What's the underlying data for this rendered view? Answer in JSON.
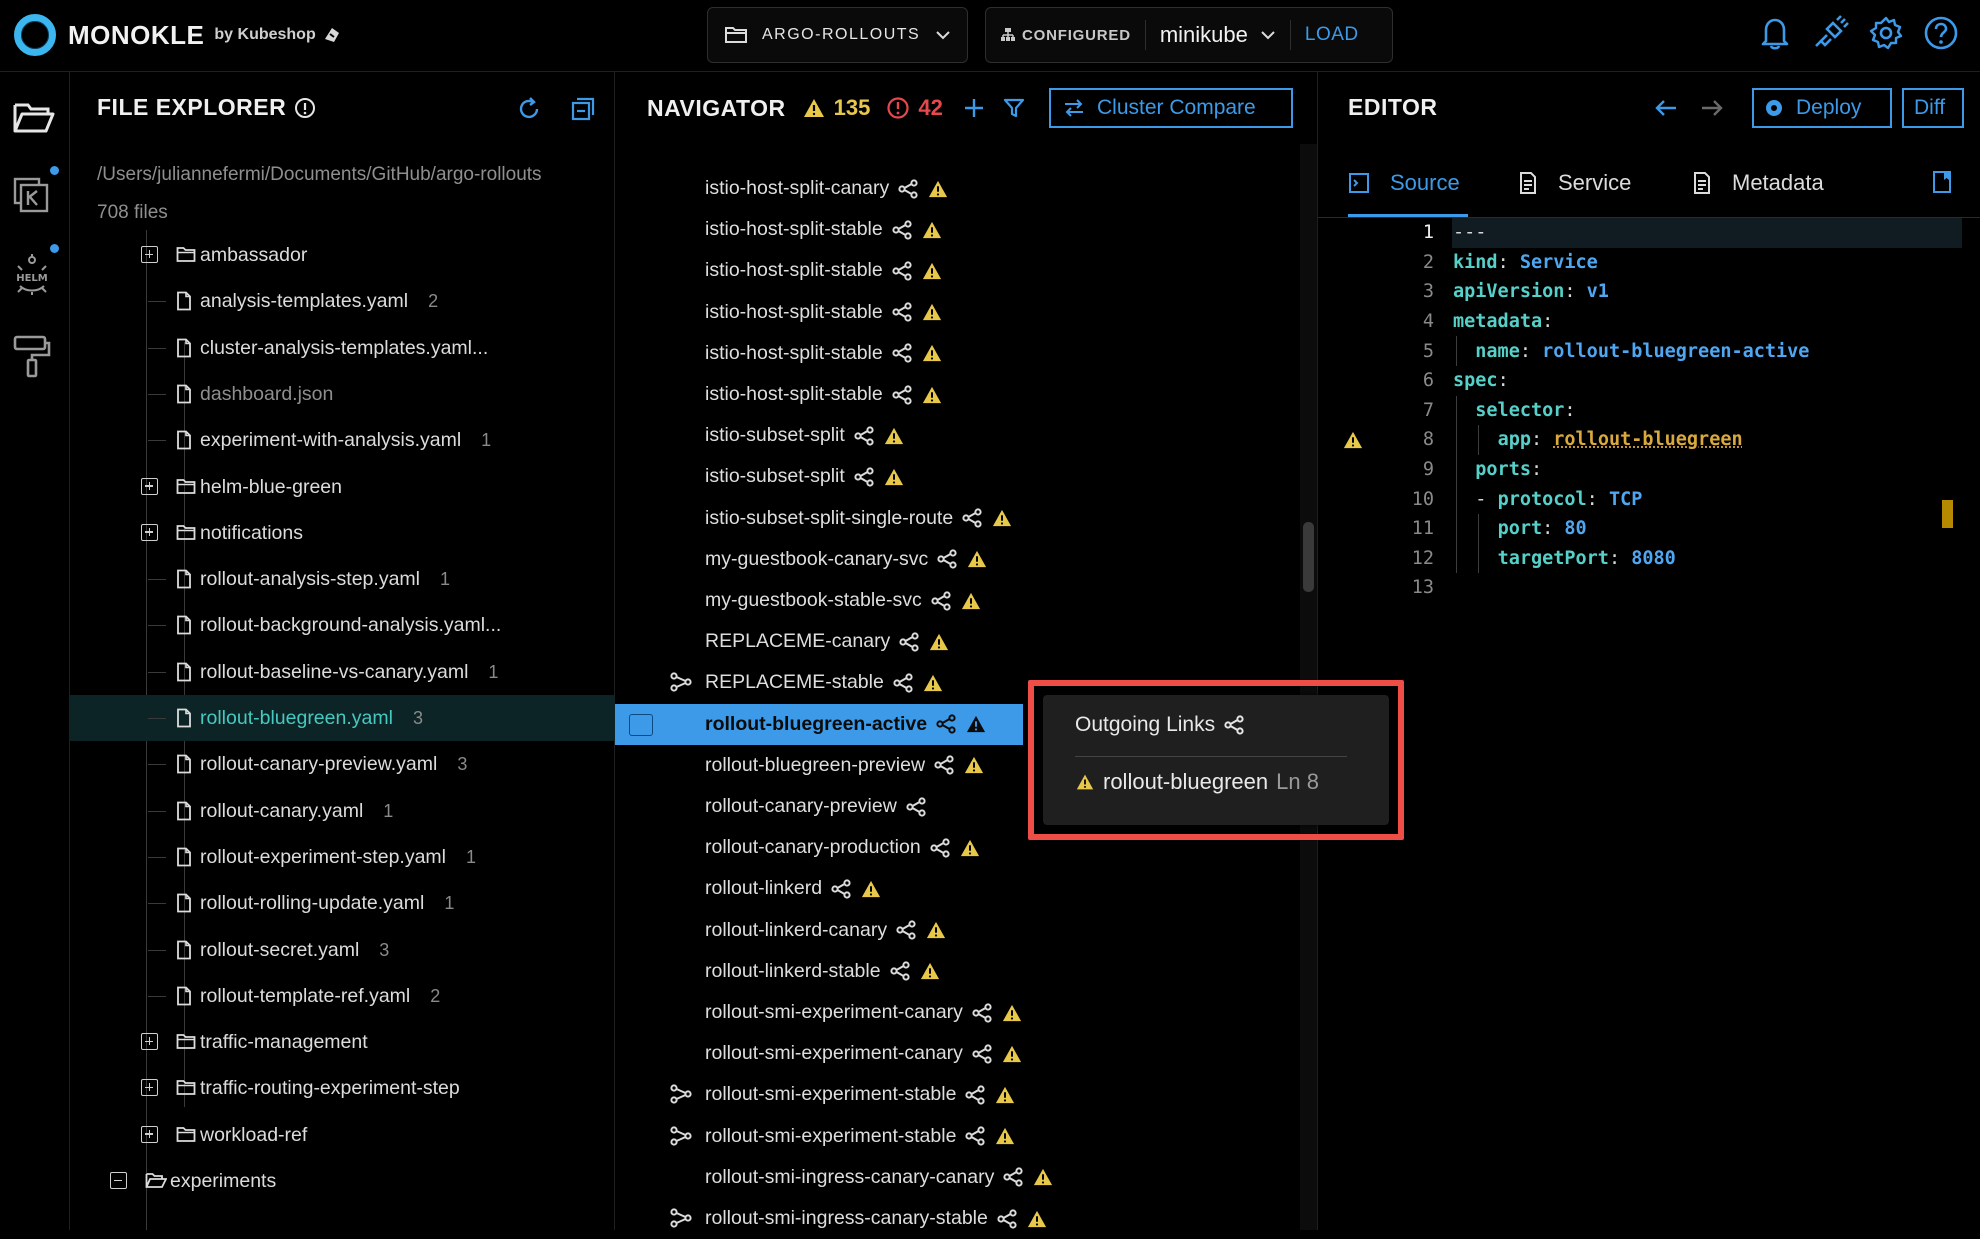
{
  "header": {
    "logo_text": "MONOKLE",
    "logo_by": "by Kubeshop",
    "project": "ARGO-ROLLOUTS",
    "configured_label": "CONFIGURED",
    "cluster": "minikube",
    "load_label": "LOAD",
    "icons": [
      "bell-icon",
      "plug-icon",
      "gear-icon",
      "help-icon"
    ]
  },
  "activity_bar": {
    "items": [
      "folder-icon",
      "kustomize-icon",
      "helm-icon",
      "paint-roller-icon"
    ],
    "helm_label": "HELM"
  },
  "file_explorer": {
    "title": "FILE EXPLORER",
    "path": "/Users/julianneferm i/Documents/GitHub/argo-rollouts",
    "file_count": "708 files",
    "items": [
      {
        "label": "ambassador",
        "type": "folder",
        "expander": "plus",
        "count": ""
      },
      {
        "label": "analysis-templates.yaml",
        "type": "file",
        "count": "2"
      },
      {
        "label": "cluster-analysis-templates.yaml...",
        "type": "file",
        "count": ""
      },
      {
        "label": "dashboard.json",
        "type": "file",
        "count": "",
        "dim": true
      },
      {
        "label": "experiment-with-analysis.yaml",
        "type": "file",
        "count": "1"
      },
      {
        "label": "helm-blue-green",
        "type": "folder",
        "expander": "plus",
        "count": ""
      },
      {
        "label": "notifications",
        "type": "folder",
        "expander": "plus",
        "count": ""
      },
      {
        "label": "rollout-analysis-step.yaml",
        "type": "file",
        "count": "1"
      },
      {
        "label": "rollout-background-analysis.yaml...",
        "type": "file",
        "count": ""
      },
      {
        "label": "rollout-baseline-vs-canary.yaml",
        "type": "file",
        "count": "1"
      },
      {
        "label": "rollout-bluegreen.yaml",
        "type": "file",
        "count": "3",
        "selected": true
      },
      {
        "label": "rollout-canary-preview.yaml",
        "type": "file",
        "count": "3"
      },
      {
        "label": "rollout-canary.yaml",
        "type": "file",
        "count": "1"
      },
      {
        "label": "rollout-experiment-step.yaml",
        "type": "file",
        "count": "1"
      },
      {
        "label": "rollout-rolling-update.yaml",
        "type": "file",
        "count": "1"
      },
      {
        "label": "rollout-secret.yaml",
        "type": "file",
        "count": "3"
      },
      {
        "label": "rollout-template-ref.yaml",
        "type": "file",
        "count": "2"
      },
      {
        "label": "traffic-management",
        "type": "folder",
        "expander": "plus",
        "count": ""
      },
      {
        "label": "traffic-routing-experiment-step",
        "type": "folder",
        "expander": "plus",
        "count": ""
      },
      {
        "label": "workload-ref",
        "type": "folder",
        "expander": "plus",
        "count": ""
      },
      {
        "label": "experiments",
        "type": "folder-open",
        "expander": "minus",
        "count": "",
        "outer": true
      }
    ]
  },
  "navigator": {
    "title": "NAVIGATOR",
    "warning_count": "135",
    "error_count": "42",
    "cluster_compare_label": "Cluster Compare",
    "items": [
      {
        "label": "istio-host-split-canary",
        "incoming": false
      },
      {
        "label": "istio-host-split-stable",
        "incoming": false
      },
      {
        "label": "istio-host-split-stable",
        "incoming": false
      },
      {
        "label": "istio-host-split-stable",
        "incoming": false
      },
      {
        "label": "istio-host-split-stable",
        "incoming": false
      },
      {
        "label": "istio-host-split-stable",
        "incoming": false
      },
      {
        "label": "istio-subset-split",
        "incoming": false
      },
      {
        "label": "istio-subset-split",
        "incoming": false
      },
      {
        "label": "istio-subset-split-single-route",
        "incoming": false
      },
      {
        "label": "my-guestbook-canary-svc",
        "incoming": false
      },
      {
        "label": "my-guestbook-stable-svc",
        "incoming": false
      },
      {
        "label": "REPLACEME-canary",
        "incoming": false
      },
      {
        "label": "REPLACEME-stable",
        "incoming": true
      },
      {
        "label": "rollout-bluegreen-active",
        "incoming": false,
        "selected": true
      },
      {
        "label": "rollout-bluegreen-preview",
        "incoming": false
      },
      {
        "label": "rollout-canary-preview",
        "incoming": false,
        "nowarn": true
      },
      {
        "label": "rollout-canary-production",
        "incoming": false
      },
      {
        "label": "rollout-linkerd",
        "incoming": false
      },
      {
        "label": "rollout-linkerd-canary",
        "incoming": false
      },
      {
        "label": "rollout-linkerd-stable",
        "incoming": false
      },
      {
        "label": "rollout-smi-experiment-canary",
        "incoming": false
      },
      {
        "label": "rollout-smi-experiment-canary",
        "incoming": false
      },
      {
        "label": "rollout-smi-experiment-stable",
        "incoming": true
      },
      {
        "label": "rollout-smi-experiment-stable",
        "incoming": true
      },
      {
        "label": "rollout-smi-ingress-canary-canary",
        "incoming": false
      },
      {
        "label": "rollout-smi-ingress-canary-stable",
        "incoming": true
      }
    ]
  },
  "popover": {
    "title": "Outgoing Links",
    "item_label": "rollout-bluegreen",
    "item_line": "Ln 8"
  },
  "editor": {
    "title": "EDITOR",
    "deploy_label": "Deploy",
    "diff_label": "Diff",
    "tabs": [
      "Source",
      "Service",
      "Metadata"
    ],
    "lines": [
      {
        "n": "1",
        "tokens": [
          [
            "p",
            "---"
          ]
        ]
      },
      {
        "n": "2",
        "tokens": [
          [
            "k",
            "kind"
          ],
          [
            "p",
            ": "
          ],
          [
            "v",
            "Service"
          ]
        ]
      },
      {
        "n": "3",
        "tokens": [
          [
            "k",
            "apiVersion"
          ],
          [
            "p",
            ": "
          ],
          [
            "v",
            "v1"
          ]
        ]
      },
      {
        "n": "4",
        "tokens": [
          [
            "k",
            "metadata"
          ],
          [
            "p",
            ":"
          ]
        ]
      },
      {
        "n": "5",
        "tokens": [
          [
            "p",
            "  "
          ],
          [
            "k",
            "name"
          ],
          [
            "p",
            ": "
          ],
          [
            "v",
            "rollout-bluegreen-active"
          ]
        ]
      },
      {
        "n": "6",
        "tokens": [
          [
            "k",
            "spec"
          ],
          [
            "p",
            ":"
          ]
        ]
      },
      {
        "n": "7",
        "tokens": [
          [
            "p",
            "  "
          ],
          [
            "k",
            "selector"
          ],
          [
            "p",
            ":"
          ]
        ]
      },
      {
        "n": "8",
        "tokens": [
          [
            "p",
            "    "
          ],
          [
            "k",
            "app"
          ],
          [
            "p",
            ": "
          ],
          [
            "y",
            "rollout-bluegreen"
          ]
        ],
        "warn": true
      },
      {
        "n": "9",
        "tokens": [
          [
            "p",
            "  "
          ],
          [
            "k",
            "ports"
          ],
          [
            "p",
            ":"
          ]
        ]
      },
      {
        "n": "10",
        "tokens": [
          [
            "p",
            "  - "
          ],
          [
            "k",
            "protocol"
          ],
          [
            "p",
            ": "
          ],
          [
            "v",
            "TCP"
          ]
        ]
      },
      {
        "n": "11",
        "tokens": [
          [
            "p",
            "    "
          ],
          [
            "k",
            "port"
          ],
          [
            "p",
            ": "
          ],
          [
            "v",
            "80"
          ]
        ]
      },
      {
        "n": "12",
        "tokens": [
          [
            "p",
            "    "
          ],
          [
            "k",
            "targetPort"
          ],
          [
            "p",
            ": "
          ],
          [
            "v",
            "8080"
          ]
        ]
      },
      {
        "n": "13",
        "tokens": []
      }
    ]
  },
  "colors": {
    "accent": "#3c9ae8",
    "warning": "#e8c84a",
    "error": "#e5484d",
    "highlight_outline": "#ee4e46"
  }
}
